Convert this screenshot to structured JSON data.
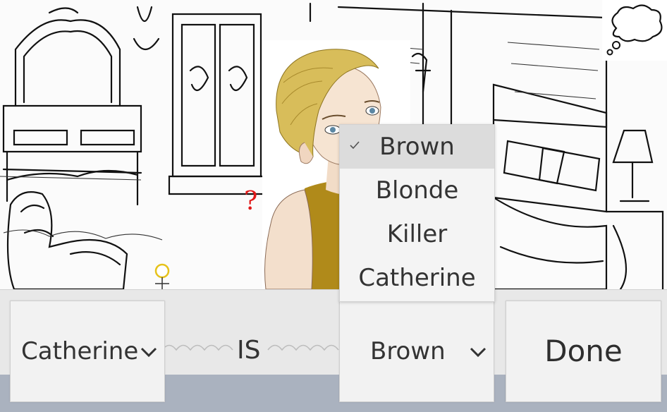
{
  "scene": {
    "question_mark": "?",
    "portrait_alt": "",
    "thought_bubble_icon": "thought-bubble"
  },
  "sentence": {
    "subject_dropdown": {
      "selected": "Catherine"
    },
    "connector": "IS",
    "attribute_dropdown": {
      "selected": "Brown",
      "options": [
        "Brown",
        "Blonde",
        "Killer",
        "Catherine"
      ]
    },
    "done_label": "Done"
  },
  "colors": {
    "question_mark": "#e01818",
    "bar_bg": "#e8e8e8",
    "bottom_strip": "#aab2bf",
    "button_bg": "#f2f2f2",
    "selected_option_bg": "#dcdcdc",
    "hair": "#d8bd5a",
    "dress": "#b08a1a"
  }
}
